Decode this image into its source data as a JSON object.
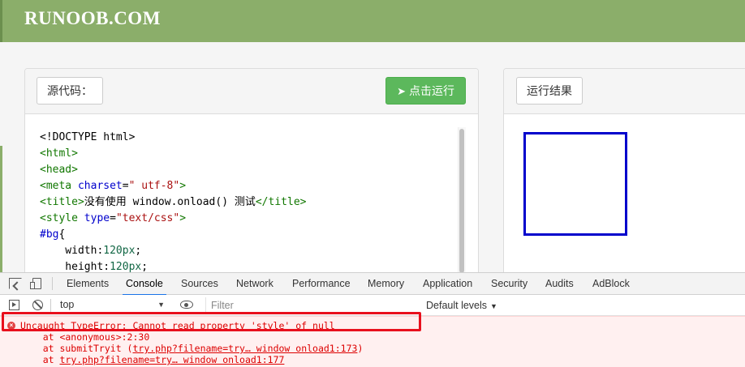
{
  "site": {
    "logo": "RUNOOB.COM"
  },
  "editor": {
    "label": "源代码：",
    "run_label": "点击运行",
    "run_icon": "paper-plane-icon",
    "code_lines": [
      {
        "parts": [
          {
            "t": "<!DOCTYPE html>",
            "c": ""
          }
        ]
      },
      {
        "parts": [
          {
            "t": "<html>",
            "c": "tag"
          }
        ]
      },
      {
        "parts": [
          {
            "t": "<head>",
            "c": "tag"
          }
        ]
      },
      {
        "parts": [
          {
            "t": "<meta ",
            "c": "tag"
          },
          {
            "t": "charset",
            "c": "attr"
          },
          {
            "t": "=",
            "c": ""
          },
          {
            "t": "\" utf-8\"",
            "c": "str"
          },
          {
            "t": ">",
            "c": "tag"
          }
        ]
      },
      {
        "parts": [
          {
            "t": "<title>",
            "c": "tag"
          },
          {
            "t": "没有使用 window.onload() 测试",
            "c": ""
          },
          {
            "t": "</title>",
            "c": "tag"
          }
        ]
      },
      {
        "parts": [
          {
            "t": "<style ",
            "c": "tag"
          },
          {
            "t": "type",
            "c": "attr"
          },
          {
            "t": "=",
            "c": ""
          },
          {
            "t": "\"text/css\"",
            "c": "str"
          },
          {
            "t": ">",
            "c": "tag"
          }
        ]
      },
      {
        "parts": [
          {
            "t": "#bg",
            "c": "attr"
          },
          {
            "t": "{",
            "c": ""
          }
        ]
      },
      {
        "parts": [
          {
            "t": "    width:",
            "c": ""
          },
          {
            "t": "120px",
            "c": "num"
          },
          {
            "t": ";",
            "c": ""
          }
        ]
      },
      {
        "parts": [
          {
            "t": "    height:",
            "c": ""
          },
          {
            "t": "120px",
            "c": "num"
          },
          {
            "t": ";",
            "c": ""
          }
        ]
      }
    ]
  },
  "result": {
    "label": "运行结果",
    "box_color": "#0000cc"
  },
  "devtools": {
    "tabs": [
      "Elements",
      "Console",
      "Sources",
      "Network",
      "Performance",
      "Memory",
      "Application",
      "Security",
      "Audits",
      "AdBlock"
    ],
    "active_tab": "Console",
    "context": "top",
    "filter_placeholder": "Filter",
    "levels": "Default levels",
    "error": {
      "message": "Uncaught TypeError: Cannot read property 'style' of null",
      "stack": [
        {
          "prefix": "    at <anonymous>:2:30",
          "link": "",
          "suffix": ""
        },
        {
          "prefix": "    at submitTryit (",
          "link": "try.php?filename=try… window onload1:173",
          "suffix": ")"
        },
        {
          "prefix": "    at ",
          "link": "try.php?filename=try… window onload1:177",
          "suffix": ""
        }
      ]
    }
  },
  "colors": {
    "header": "#8bae6a",
    "run_button": "#5cb85c",
    "error_text": "#dd0000",
    "highlight": "#e8101d"
  }
}
